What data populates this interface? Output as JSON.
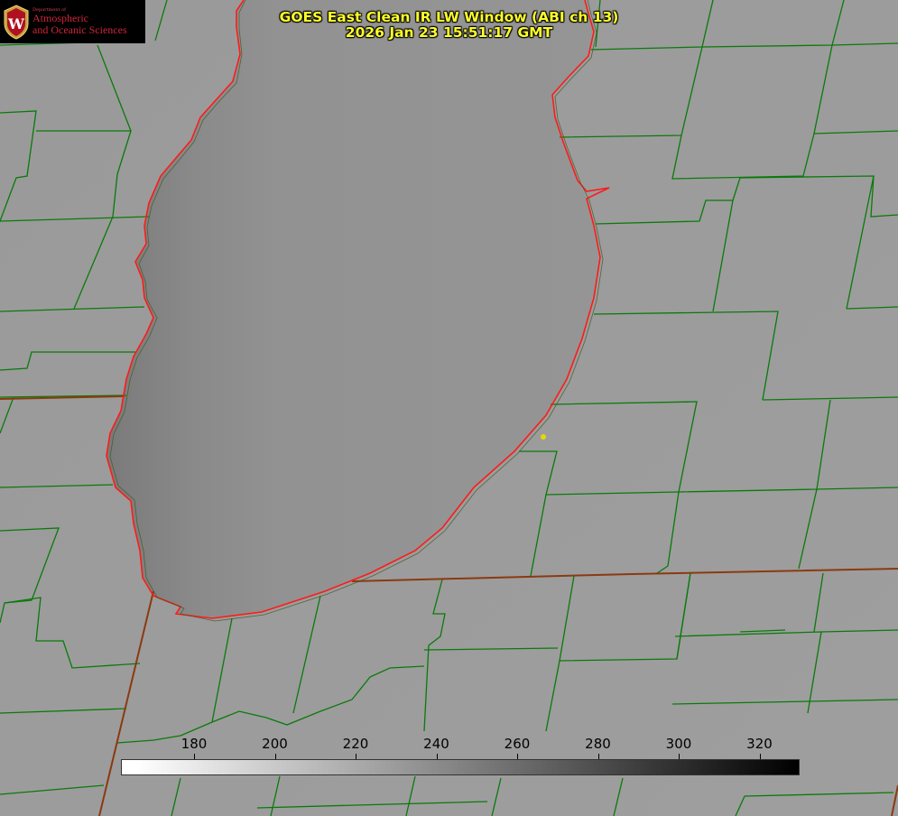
{
  "header": {
    "title_line1": "GOES East Clean IR LW Window (ABI ch 13)",
    "title_line2": "2026 Jan 23 15:51:17 GMT"
  },
  "logo": {
    "seal_letter": "W",
    "dept": "Department of",
    "line1": "Atmospheric",
    "line2": "and Oceanic Sciences"
  },
  "colorbar": {
    "ticks": [
      "180",
      "200",
      "220",
      "240",
      "260",
      "280",
      "300",
      "320"
    ],
    "gradient_start": "#ffffff",
    "gradient_end": "#000000"
  },
  "colors": {
    "background": "#9b9b9b",
    "lake": "#8f8f8f",
    "county_lines": "#0a7a0a",
    "shoreline": "#ff1a1a",
    "state_lines": "#8b3a10",
    "title": "#ffff2a",
    "marker": "#e8d800"
  }
}
